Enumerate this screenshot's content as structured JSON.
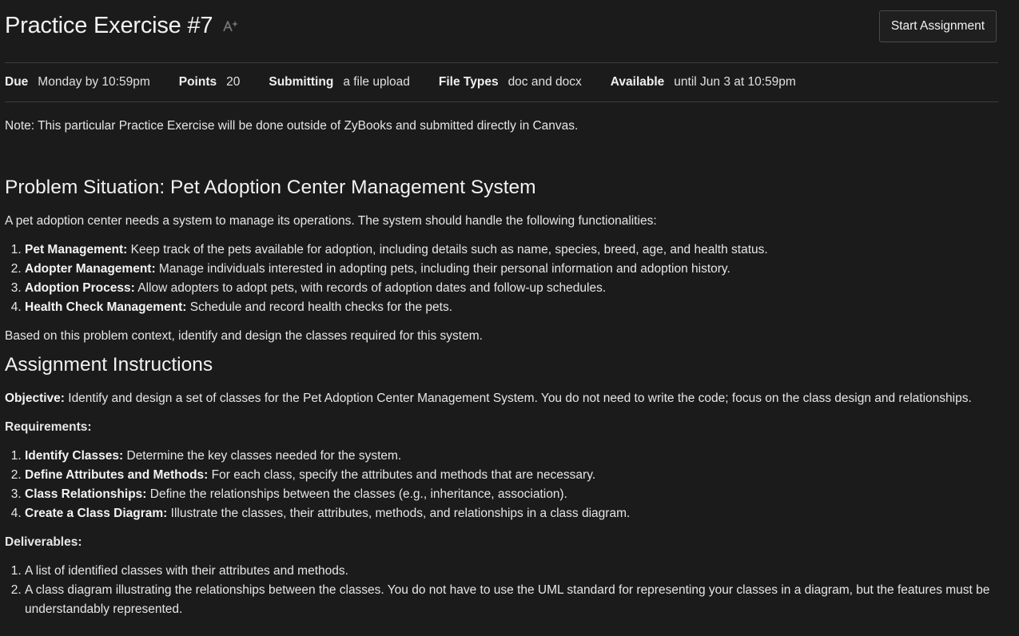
{
  "header": {
    "title": "Practice Exercise #7",
    "start_button": "Start Assignment"
  },
  "meta": [
    {
      "label": "Due",
      "value": "Monday by 10:59pm"
    },
    {
      "label": "Points",
      "value": "20"
    },
    {
      "label": "Submitting",
      "value": "a file upload"
    },
    {
      "label": "File Types",
      "value": "doc and docx"
    },
    {
      "label": "Available",
      "value": "until Jun 3 at 10:59pm"
    }
  ],
  "note": "Note:  This particular Practice Exercise will be done outside of ZyBooks and submitted directly in Canvas.",
  "problem": {
    "heading": "Problem Situation: Pet Adoption Center Management System",
    "intro": "A pet adoption center needs a system to manage its operations. The system should handle the following functionalities:",
    "items": [
      {
        "bold": "Pet Management:",
        "text": " Keep track of the pets available for adoption, including details such as name, species, breed, age, and health status."
      },
      {
        "bold": "Adopter Management:",
        "text": " Manage individuals interested in adopting pets, including their personal information and adoption history."
      },
      {
        "bold": "Adoption Process:",
        "text": " Allow adopters to adopt pets, with records of adoption dates and follow-up schedules."
      },
      {
        "bold": "Health Check Management:",
        "text": " Schedule and record health checks for the pets."
      }
    ],
    "closing": "Based on this problem context, identify and design the classes required for this system."
  },
  "instructions": {
    "heading": "Assignment Instructions",
    "objective_label": "Objective:",
    "objective_text": " Identify and design a set of classes for the Pet Adoption Center Management System. You do not need to write the code; focus on the class design and relationships.",
    "requirements_label": "Requirements:",
    "requirements": [
      {
        "bold": "Identify Classes:",
        "text": " Determine the key classes needed for the system."
      },
      {
        "bold": "Define Attributes and Methods:",
        "text": " For each class, specify the attributes and methods that are necessary."
      },
      {
        "bold": "Class Relationships:",
        "text": " Define the relationships between the classes (e.g., inheritance, association)."
      },
      {
        "bold": "Create a Class Diagram:",
        "text": " Illustrate the classes, their attributes, methods, and relationships in a class diagram."
      }
    ],
    "deliverables_label": "Deliverables:",
    "deliverables": [
      "A list of identified classes with their attributes and methods.",
      "A class diagram illustrating the relationships between the classes.  You do not have to use the UML standard for representing your classes in a diagram, but the features must be understandably represented."
    ]
  }
}
